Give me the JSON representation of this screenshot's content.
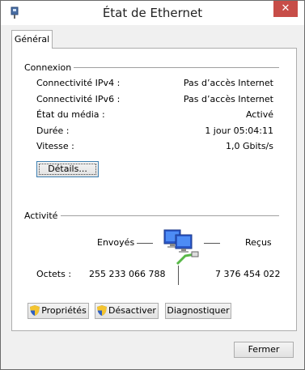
{
  "window": {
    "title": "État de Ethernet",
    "close_glyph": "✕"
  },
  "tabs": [
    {
      "label": "Général"
    }
  ],
  "connection": {
    "heading": "Connexion",
    "rows": [
      {
        "label": "Connectivité IPv4 :",
        "value": "Pas d’accès Internet"
      },
      {
        "label": "Connectivité IPv6 :",
        "value": "Pas d’accès Internet"
      },
      {
        "label": "État du média :",
        "value": "Activé"
      },
      {
        "label": "Durée :",
        "value": "1 jour 05:04:11"
      },
      {
        "label": "Vitesse :",
        "value": "1,0 Gbits/s"
      }
    ],
    "details_button": "Détails..."
  },
  "activity": {
    "heading": "Activité",
    "sent_label": "Envoyés",
    "received_label": "Reçus",
    "bytes_label": "Octets :",
    "bytes_sent": "255 233 066 788",
    "bytes_received": "7 376 454 022",
    "network_icon": "network-computers-icon"
  },
  "buttons": {
    "properties": "Propriétés",
    "disable": "Désactiver",
    "diagnose": "Diagnostiquer",
    "close": "Fermer"
  },
  "colors": {
    "close_button": "#c74d48",
    "window_bg": "#f0f0f0",
    "panel_bg": "#ffffff"
  }
}
